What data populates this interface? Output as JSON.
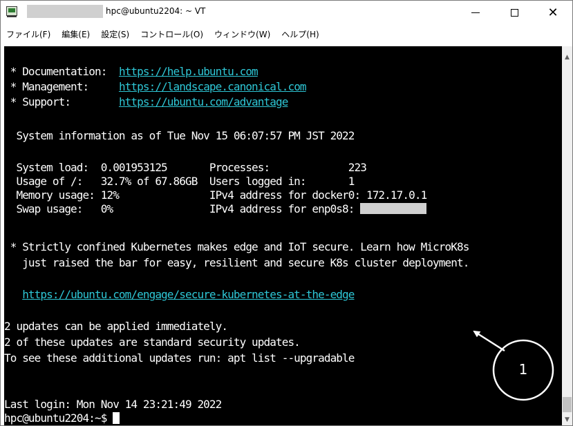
{
  "window": {
    "title": "hpc@ubuntu2204: ~ VT",
    "controls": {
      "minimize": "minimize",
      "maximize": "maximize",
      "close": "✕"
    }
  },
  "menu": [
    "ファイル(F)",
    "編集(E)",
    "設定(S)",
    "コントロール(O)",
    "ウィンドウ(W)",
    "ヘルプ(H)"
  ],
  "terminal": {
    "doc_label": " * Documentation:  ",
    "doc_url": "https://help.ubuntu.com",
    "mgmt_label": " * Management:     ",
    "mgmt_url": "https://landscape.canonical.com",
    "support_label": " * Support:        ",
    "support_url": "https://ubuntu.com/advantage",
    "sysinfo": "  System information as of Tue Nov 15 06:07:57 PM JST 2022",
    "stats_1": "  System load:  0.001953125       Processes:             223",
    "stats_2": "  Usage of /:   32.7% of 67.86GB  Users logged in:       1",
    "stats_3": "  Memory usage: 12%               IPv4 address for docker0: 172.17.0.1",
    "stats_4": "  Swap usage:   0%                IPv4 address for enp0s8: ",
    "k8s_1": " * Strictly confined Kubernetes makes edge and IoT secure. Learn how MicroK8s",
    "k8s_2": "   just raised the bar for easy, resilient and secure K8s cluster deployment.",
    "engage_url": "https://ubuntu.com/engage/secure-kubernetes-at-the-edge",
    "updates_1": "2 updates can be applied immediately.",
    "updates_2": "2 of these updates are standard security updates.",
    "updates_3": "To see these additional updates run: apt list --upgradable",
    "last_login": "Last login: Mon Nov 14 23:21:49 2022",
    "prompt": "hpc@ubuntu2204:~$ "
  },
  "annotation": {
    "label": "1"
  },
  "colors": {
    "terminal_bg": "#000000",
    "terminal_fg": "#ffffff",
    "link": "#2ec7d6"
  }
}
